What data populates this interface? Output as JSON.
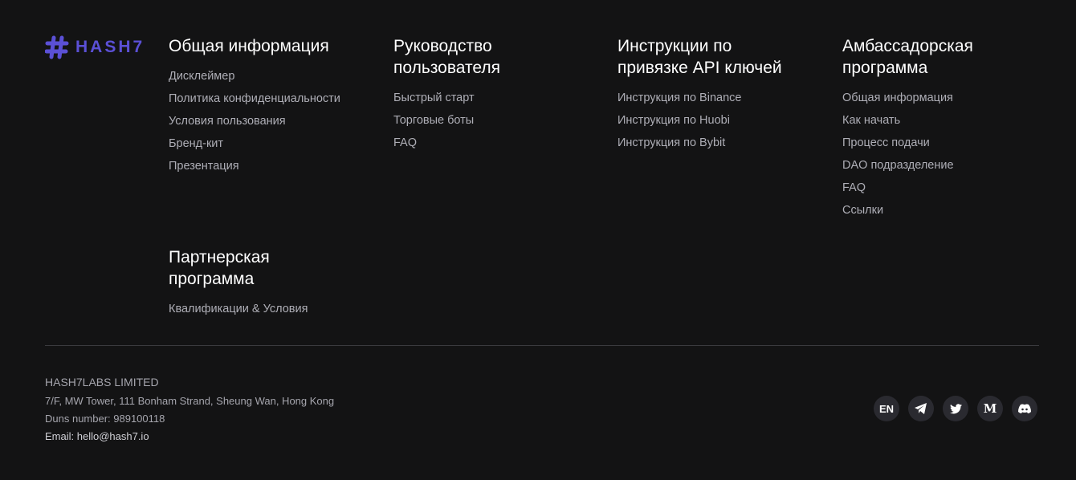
{
  "logo": {
    "text": "HASH7",
    "color": "#5b50d6"
  },
  "columns": [
    {
      "title": "Общая информация",
      "links": [
        "Дисклеймер",
        "Политика конфиденциальности",
        "Условия пользования",
        "Бренд-кит",
        "Презентация"
      ]
    },
    {
      "title_lines": [
        "Руководство",
        "пользователя"
      ],
      "links": [
        "Быстрый старт",
        "Торговые боты",
        "FAQ"
      ]
    },
    {
      "title_lines": [
        "Инструкции по",
        "привязке API ключей"
      ],
      "links": [
        "Инструкция по Binance",
        "Инструкция по Huobi",
        "Инструкция по Bybit"
      ]
    },
    {
      "title_lines": [
        "Амбассадорская",
        "программа"
      ],
      "links": [
        "Общая информация",
        "Как начать",
        "Процесс подачи",
        "DAO подразделение",
        "FAQ",
        "Ссылки"
      ]
    },
    {
      "title_lines": [
        "Партнерская",
        "программа"
      ],
      "links": [
        "Квалификации & Условия"
      ]
    }
  ],
  "company": {
    "name": "HASH7LABS LIMITED",
    "address": "7/F, MW Tower, 111 Bonham Strand, Sheung Wan, Hong Kong",
    "duns": "Duns number: 989100118",
    "email": "Email: hello@hash7.io"
  },
  "social": {
    "lang": "EN",
    "medium": "M"
  }
}
